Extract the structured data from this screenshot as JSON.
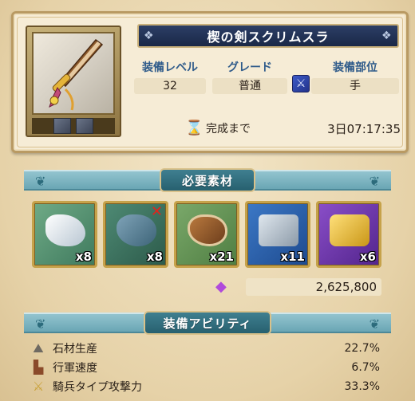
{
  "item": {
    "name": "楔の剣スクリムスラ",
    "stats": [
      {
        "label": "装備レベル",
        "value": "32"
      },
      {
        "label": "グレード",
        "value": "普通"
      },
      {
        "label": "装備部位",
        "value": "手"
      }
    ],
    "slot_icon": "sword-icon",
    "timer_label": "完成まで",
    "timer_value": "3日07:17:35"
  },
  "materials_section": {
    "title": "必要素材",
    "materials": [
      {
        "icon": "white-stone-icon",
        "count": "x8",
        "missing": false
      },
      {
        "icon": "blue-ore-icon",
        "count": "x8",
        "missing": true
      },
      {
        "icon": "leather-icon",
        "count": "x21",
        "missing": false
      },
      {
        "icon": "steel-plate-icon",
        "count": "x11",
        "missing": false
      },
      {
        "icon": "gold-ornament-icon",
        "count": "x6",
        "missing": false
      }
    ],
    "missing_mark": "✕",
    "cost_icon": "crystal-icon",
    "cost": "2,625,800"
  },
  "abilities_section": {
    "title": "装備アビリティ",
    "abilities": [
      {
        "icon": "stone-icon",
        "name": "石材生産",
        "value": "22.7%"
      },
      {
        "icon": "boot-icon",
        "name": "行軍速度",
        "value": "6.7%"
      },
      {
        "icon": "sword-icon",
        "name": "騎兵タイプ攻撃力",
        "value": "33.3%"
      }
    ]
  }
}
